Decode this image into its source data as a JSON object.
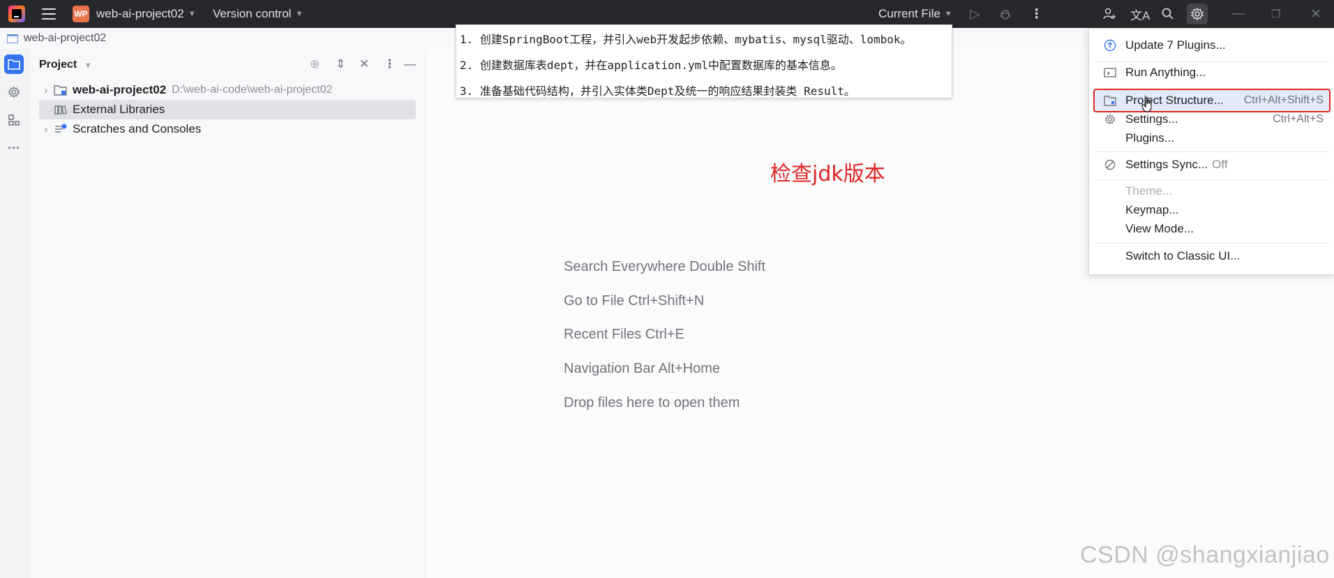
{
  "titlebar": {
    "project_badge": "WP",
    "project_name": "web-ai-project02",
    "version_control": "Version control",
    "run_config": "Current File"
  },
  "breadcrumb": {
    "label": "web-ai-project02"
  },
  "project_panel": {
    "title": "Project",
    "tree": [
      {
        "name": "web-ai-project02",
        "path": "D:\\web-ai-code\\web-ai-project02",
        "expandable": true
      },
      {
        "name": "External Libraries",
        "selected": true
      },
      {
        "name": "Scratches and Consoles",
        "expandable": true
      }
    ]
  },
  "steps_note": [
    "1. 创建SpringBoot工程，并引入web开发起步依赖、mybatis、mysql驱动、lombok。",
    "2. 创建数据库表dept，并在application.yml中配置数据库的基本信息。",
    "3. 准备基础代码结构，并引入实体类Dept及统一的响应结果封装类 Result。"
  ],
  "annotation": "检查jdk版本",
  "editor_hints": [
    "Search Everywhere Double Shift",
    "Go to File Ctrl+Shift+N",
    "Recent Files Ctrl+E",
    "Navigation Bar Alt+Home",
    "Drop files here to open them"
  ],
  "menu": {
    "update_plugins": "Update 7 Plugins...",
    "run_anything": "Run Anything...",
    "project_structure": {
      "label": "Project Structure...",
      "shortcut": "Ctrl+Alt+Shift+S"
    },
    "settings": {
      "label": "Settings...",
      "shortcut": "Ctrl+Alt+S"
    },
    "plugins": "Plugins...",
    "settings_sync": {
      "label": "Settings Sync...",
      "state": "Off"
    },
    "theme": "Theme...",
    "keymap": "Keymap...",
    "view_mode": "View Mode...",
    "classic_ui": "Switch to Classic UI..."
  },
  "watermark": "CSDN @shangxianjiao",
  "colors": {
    "accent": "#3574f0",
    "highlight_border": "#e02424",
    "titlebar_bg": "#27282c"
  }
}
